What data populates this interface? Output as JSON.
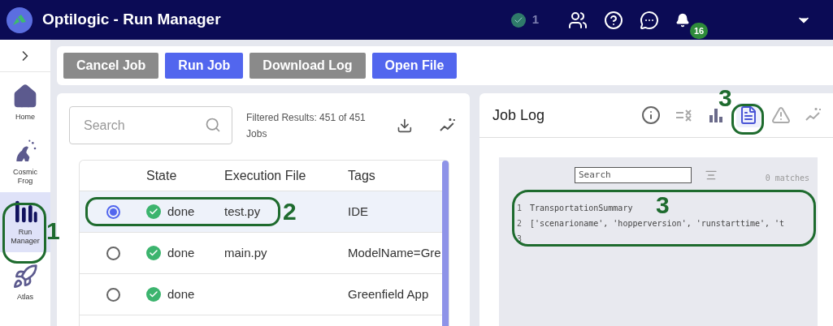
{
  "header": {
    "title": "Optilogic - Run Manager",
    "status_count": "1",
    "notification_count": "16"
  },
  "sidebar": {
    "items": [
      {
        "label": "Home",
        "kind": "home",
        "selected": false
      },
      {
        "label": "Cosmic Frog",
        "kind": "frog",
        "selected": false
      },
      {
        "label": "Run Manager",
        "kind": "bars",
        "selected": true
      },
      {
        "label": "Atlas",
        "kind": "rocket",
        "selected": false
      }
    ]
  },
  "toolbar": {
    "buttons": [
      {
        "label": "Cancel Job",
        "disabled": true
      },
      {
        "label": "Run Job",
        "disabled": false
      },
      {
        "label": "Download Log",
        "disabled": true
      },
      {
        "label": "Open File",
        "disabled": false
      }
    ]
  },
  "jobs": {
    "search": {
      "placeholder": "Search"
    },
    "results": "Filtered Results: 451 of 451 Jobs",
    "columns": [
      "State",
      "Execution File",
      "Tags"
    ],
    "rows": [
      {
        "selected": true,
        "state": "done",
        "file": "test.py",
        "tags": "IDE"
      },
      {
        "selected": false,
        "state": "done",
        "file": "main.py",
        "tags": "ModelName=Gre"
      },
      {
        "selected": false,
        "state": "done",
        "tags": "Greenfield App"
      }
    ]
  },
  "job_log": {
    "title": "Job Log",
    "tools": [
      {
        "kind": "info",
        "selected": false
      },
      {
        "kind": "clear",
        "selected": false
      },
      {
        "kind": "chart",
        "selected": false
      },
      {
        "kind": "document",
        "selected": true
      },
      {
        "kind": "warning",
        "selected": false
      },
      {
        "kind": "sparkle",
        "selected": false
      }
    ],
    "search": {
      "placeholder": "Search"
    },
    "matches": "0 matches",
    "lines": [
      {
        "number": "1",
        "text": "TransportationSummary"
      },
      {
        "number": "2",
        "text": "['scenarioname', 'hopperversion', 'runstarttime', 't"
      },
      {
        "number": "3"
      }
    ]
  },
  "annotations": [
    "1",
    "2",
    "3",
    "3"
  ]
}
